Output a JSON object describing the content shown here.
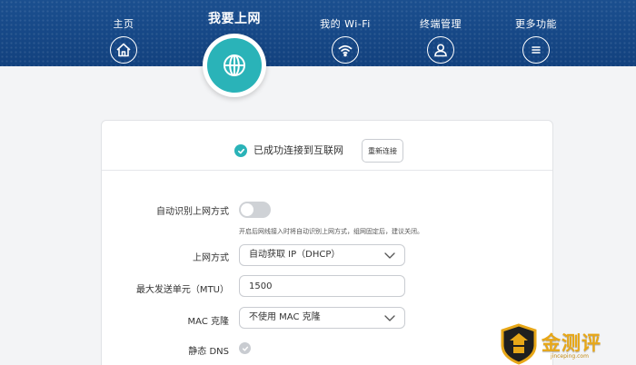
{
  "nav": {
    "items": [
      {
        "label": "主页",
        "icon": "home-icon"
      },
      {
        "label": "我要上网",
        "icon": "globe-icon",
        "active": true
      },
      {
        "label": "我的 Wi-Fi",
        "icon": "wifi-icon"
      },
      {
        "label": "终端管理",
        "icon": "user-icon"
      },
      {
        "label": "更多功能",
        "icon": "menu-icon"
      }
    ]
  },
  "status": {
    "text": "已成功连接到互联网",
    "reconnect_label": "重新连接"
  },
  "form": {
    "auto_detect_label": "自动识别上网方式",
    "auto_detect_hint": "开启后网线接入时将自动识别上网方式，组网固定后，建议关闭。",
    "auto_detect_on": false,
    "wan_mode_label": "上网方式",
    "wan_mode_value": "自动获取 IP（DHCP）",
    "mtu_label": "最大发送单元（MTU）",
    "mtu_value": "1500",
    "mac_clone_label": "MAC 克隆",
    "mac_clone_value": "不使用 MAC 克隆",
    "static_dns_label": "静态 DNS"
  },
  "watermark": {
    "text": "金测评",
    "url": "jinceping.com"
  },
  "colors": {
    "header": "#12417e",
    "accent": "#2ab3b8",
    "watermark": "#e7a718"
  }
}
